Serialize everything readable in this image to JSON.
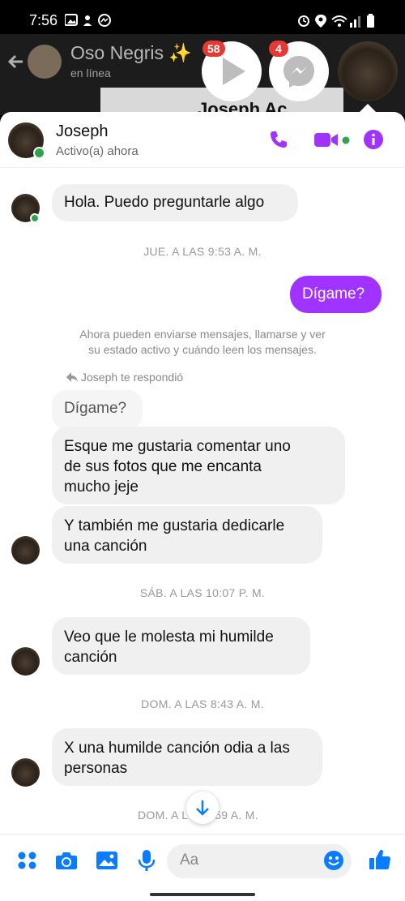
{
  "status_bar": {
    "time": "7:56"
  },
  "background_chat": {
    "contact_name": "Oso Negris ✨",
    "contact_status": "en línea",
    "card_text": "Joseph Ac"
  },
  "chat_heads": {
    "video_badge": "58",
    "messenger_badge": "4"
  },
  "header": {
    "name": "Joseph",
    "status": "Activo(a) ahora"
  },
  "messages": [
    {
      "text": "Hola. Puedo preguntarle algo"
    },
    {
      "text": "JUE. A LAS 9:53 A. M."
    },
    {
      "text": "Dígame?"
    },
    {
      "text": "Ahora pueden enviarse mensajes, llamarse y ver"
    },
    {
      "text": "su estado activo y cuándo leen los mensajes."
    },
    {
      "text": "Joseph te respondió"
    },
    {
      "text": "Dígame?"
    },
    {
      "text": "Esque me gustaria comentar uno"
    },
    {
      "text": "de sus fotos que me encanta"
    },
    {
      "text": "mucho jeje"
    },
    {
      "text": "Y también me gustaria dedicarle"
    },
    {
      "text": "una canción"
    },
    {
      "text": "SÁB. A LAS 10:07 P. M."
    },
    {
      "text": "Veo que le molesta mi humilde"
    },
    {
      "text": "canción"
    },
    {
      "text": "DOM. A LAS 8:43 A. M."
    },
    {
      "text": "X una humilde canción odia a las"
    },
    {
      "text": "personas"
    },
    {
      "text": "DOM. A L"
    },
    {
      "text": ":59 A. M."
    }
  ],
  "composer": {
    "placeholder": "Aa"
  },
  "colors": {
    "accent": "#a033ff",
    "online": "#31a24c",
    "blue": "#0a7cff"
  }
}
